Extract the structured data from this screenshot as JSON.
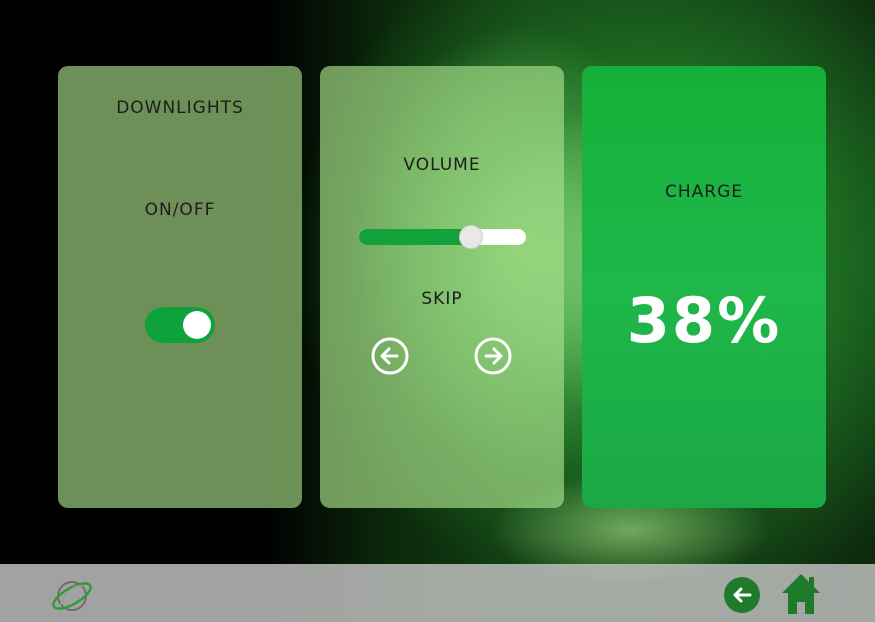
{
  "cards": {
    "lights": {
      "title": "DOWNLIGHTS",
      "subtitle": "ON/OFF",
      "toggle_on": true
    },
    "volume": {
      "title": "VOLUME",
      "level": 0.67,
      "skip_label": "SKIP"
    },
    "charge": {
      "title": "CHARGE",
      "value": "38%"
    }
  },
  "icons": {
    "skip_back": "arrow-left-circle-icon",
    "skip_forward": "arrow-right-circle-icon",
    "back": "back-arrow-icon",
    "home": "home-icon",
    "logo": "orbit-logo"
  },
  "colors": {
    "accent": "#12a23c",
    "charge_card": "#1fb74a",
    "bottom_bar": "#bebebe",
    "icon_green": "#1f7a2b"
  }
}
